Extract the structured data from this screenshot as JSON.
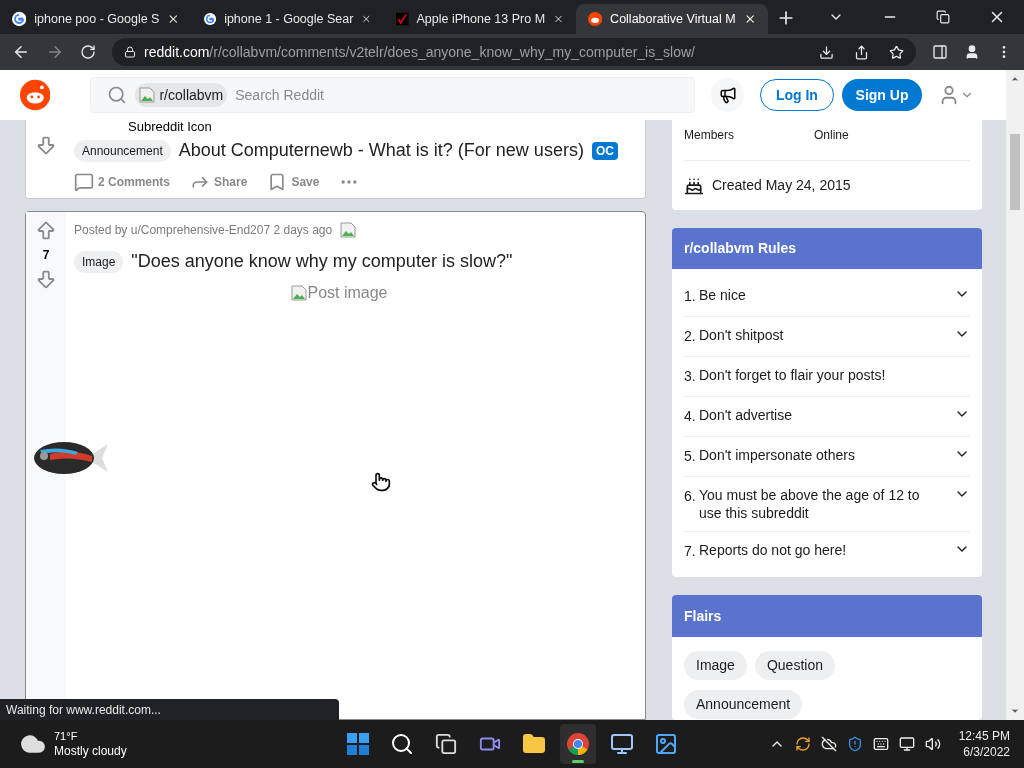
{
  "browser": {
    "tabs": [
      {
        "title": "iphone poo - Google S",
        "kind": "google",
        "selected": false
      },
      {
        "title": "iphone 1 - Google Sear",
        "kind": "google",
        "selected": false
      },
      {
        "title": "Apple iPhone 13 Pro M",
        "kind": "check",
        "selected": false
      },
      {
        "title": "Collaborative Virtual M",
        "kind": "reddit",
        "selected": true
      }
    ],
    "url_host": "reddit.com",
    "url_path": "/r/collabvm/comments/v2telr/does_anyone_know_why_my_computer_is_slow/"
  },
  "header": {
    "subreddit": "r/collabvm",
    "icon_alt": "Subreddit Icon",
    "search_placeholder": "Search Reddit",
    "login": "Log In",
    "signup": "Sign Up"
  },
  "posts": [
    {
      "flair": "Announcement",
      "title": "About Computernewb - What is it? (For new users)",
      "badge": "OC",
      "actions": [
        "2 Comments",
        "Share",
        "Save"
      ]
    },
    {
      "votes": "7",
      "posted_by": "Posted by u/Comprehensive-End207 2 days ago",
      "flair": "Image",
      "title": "\"Does anyone know why my computer is slow?\"",
      "image_alt": "Post image"
    }
  ],
  "about": {
    "members": "Members",
    "online": "Online",
    "created": "Created May 24, 2015"
  },
  "rules": {
    "title": "r/collabvm Rules",
    "items": [
      {
        "num": "1.",
        "text": "Be nice",
        "expandable": true
      },
      {
        "num": "2.",
        "text": "Don't shitpost",
        "expandable": true
      },
      {
        "num": "3.",
        "text": "Don't forget to flair your posts!",
        "expandable": false
      },
      {
        "num": "4.",
        "text": "Don't advertise",
        "expandable": true
      },
      {
        "num": "5.",
        "text": "Don't impersonate others",
        "expandable": true
      },
      {
        "num": "6.",
        "text": "You must be above the age of 12 to use this subreddit",
        "expandable": true
      },
      {
        "num": "7.",
        "text": "Reports do not go here!",
        "expandable": true
      }
    ]
  },
  "flairs": {
    "title": "Flairs",
    "items": [
      "Image",
      "Question",
      "Announcement"
    ]
  },
  "status": "Waiting for www.reddit.com...",
  "taskbar": {
    "temp": "71°F",
    "weather": "Mostly cloudy",
    "apps": [
      {
        "kind": "start",
        "active": false
      },
      {
        "kind": "search",
        "active": false
      },
      {
        "kind": "taskview",
        "active": false
      },
      {
        "kind": "chat",
        "active": false
      },
      {
        "kind": "files",
        "active": false
      },
      {
        "kind": "chrome",
        "active": true
      },
      {
        "kind": "remote",
        "active": false
      },
      {
        "kind": "photos",
        "active": false
      }
    ],
    "time": "12:45 PM",
    "date": "6/3/2022"
  }
}
